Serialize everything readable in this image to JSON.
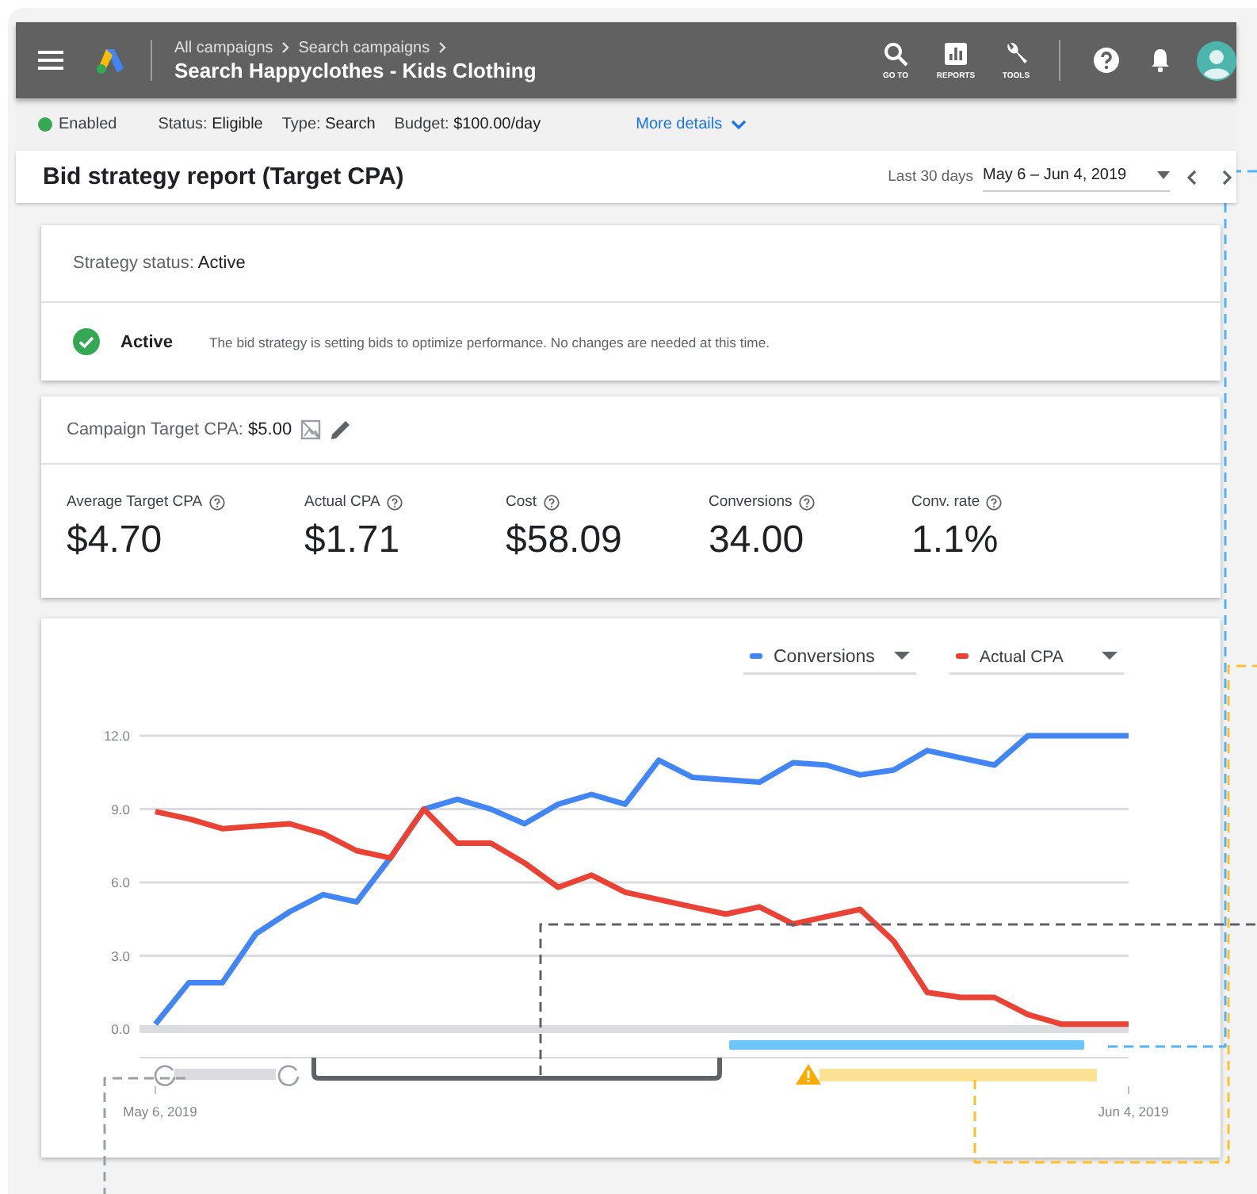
{
  "header": {
    "breadcrumbs": [
      "All campaigns",
      "Search campaigns"
    ],
    "title": "Search Happyclothes - Kids Clothing",
    "actions": [
      {
        "label": "GO TO",
        "kind": "search"
      },
      {
        "label": "REPORTS",
        "kind": "reports"
      },
      {
        "label": "TOOLS",
        "kind": "tools"
      }
    ]
  },
  "summary_bar": {
    "state": "Enabled",
    "fields": [
      {
        "label": "Status:",
        "value": "Eligible"
      },
      {
        "label": "Type:",
        "value": "Search"
      },
      {
        "label": "Budget:",
        "value": "$100.00/day"
      }
    ],
    "link": "More details"
  },
  "report": {
    "title": "Bid strategy report (Target CPA)",
    "range_label": "Last 30 days",
    "range": "May 6 – Jun 4, 2019"
  },
  "strategy_status": {
    "label": "Strategy status:",
    "value": "Active",
    "state": "Active",
    "message": "The bid strategy is setting bids to optimize performance. No changes are needed at this time."
  },
  "target": {
    "label": "Campaign Target CPA:",
    "value": "$5.00"
  },
  "metrics": [
    {
      "label": "Average Target CPA",
      "value": "$4.70"
    },
    {
      "label": "Actual CPA",
      "value": "$1.71"
    },
    {
      "label": "Cost",
      "value": "$58.09"
    },
    {
      "label": "Conversions",
      "value": "34.00"
    },
    {
      "label": "Conv. rate",
      "value": "1.1%"
    }
  ],
  "chart": {
    "chart_data": {
      "type": "line",
      "categories": [
        "May 6, 2019",
        null,
        null,
        null,
        null,
        null,
        null,
        null,
        null,
        null,
        null,
        null,
        null,
        null,
        null,
        null,
        null,
        null,
        null,
        null,
        null,
        null,
        null,
        null,
        null,
        null,
        null,
        null,
        null,
        "Jun 4, 2019"
      ],
      "series": [
        {
          "name": "Conversions",
          "color": "#4285f4",
          "values": [
            0.2,
            1.9,
            1.9,
            3.9,
            4.8,
            5.5,
            5.2,
            7.0,
            9.0,
            9.4,
            9.0,
            8.4,
            9.2,
            9.6,
            9.2,
            11.0,
            10.3,
            10.2,
            10.1,
            10.9,
            10.8,
            10.4,
            10.6,
            11.4,
            11.1,
            10.8,
            12.0,
            12.0,
            12.0,
            12.0
          ]
        },
        {
          "name": "Actual CPA",
          "color": "#ea4335",
          "values": [
            8.9,
            8.6,
            8.2,
            8.3,
            8.4,
            8.0,
            7.3,
            7.0,
            9.0,
            7.6,
            7.6,
            6.8,
            5.8,
            6.3,
            5.6,
            5.3,
            5.0,
            4.7,
            5.0,
            4.3,
            4.6,
            4.9,
            3.6,
            1.5,
            1.3,
            1.3,
            0.6,
            0.2,
            0.2,
            0.2
          ]
        }
      ],
      "ylim": [
        0,
        12
      ],
      "grid": true,
      "legend": "top-right",
      "yticks": [
        {
          "value": 0,
          "label": "0.0"
        },
        {
          "value": 3,
          "label": "3.0"
        },
        {
          "value": 6,
          "label": "6.0"
        },
        {
          "value": 9,
          "label": "9.0"
        },
        {
          "value": 12,
          "label": "12.0"
        }
      ]
    }
  }
}
